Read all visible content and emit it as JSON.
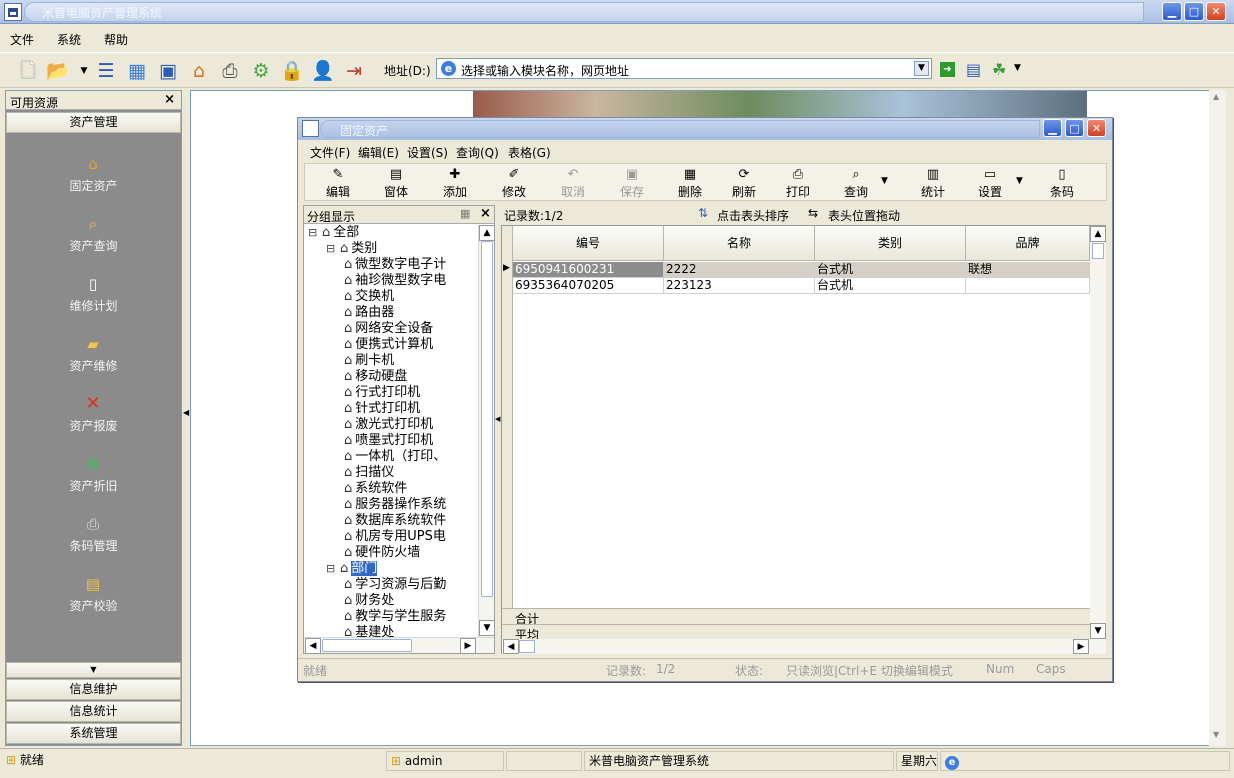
{
  "window": {
    "title": "米普电脑资产管理系统"
  },
  "menubar": [
    "文件",
    "系统",
    "帮助"
  ],
  "address": {
    "label": "地址(D:)",
    "value": "选择或输入模块名称，网页地址"
  },
  "sidebar": {
    "header": "可用资源",
    "close": "×",
    "section_top": "资产管理",
    "items": [
      {
        "label": "固定资产",
        "icon": "house-icon"
      },
      {
        "label": "资产查询",
        "icon": "magnifier-icon"
      },
      {
        "label": "维修计划",
        "icon": "document-icon"
      },
      {
        "label": "资产维修",
        "icon": "folder-icon"
      },
      {
        "label": "资产报废",
        "icon": "red-x-icon"
      },
      {
        "label": "资产折旧",
        "icon": "recycle-icon"
      },
      {
        "label": "条码管理",
        "icon": "printer-icon"
      },
      {
        "label": "资产校验",
        "icon": "checklist-icon"
      }
    ],
    "bottom_sections": [
      "信息维护",
      "信息统计",
      "系统管理"
    ]
  },
  "child": {
    "title": "固定资产",
    "menu": [
      "文件(F)",
      "编辑(E)",
      "设置(S)",
      "查询(Q)",
      "表格(G)"
    ],
    "toolbar": [
      {
        "label": "编辑",
        "icon": "✎",
        "disabled": false
      },
      {
        "label": "窗体",
        "icon": "▤",
        "disabled": false
      },
      {
        "label": "添加",
        "icon": "✚",
        "disabled": false
      },
      {
        "label": "修改",
        "icon": "✐",
        "disabled": false
      },
      {
        "label": "取消",
        "icon": "↶",
        "disabled": true
      },
      {
        "label": "保存",
        "icon": "▣",
        "disabled": true
      },
      {
        "label": "删除",
        "icon": "▦",
        "disabled": false
      },
      {
        "label": "刷新",
        "icon": "⟳",
        "disabled": false
      },
      {
        "label": "打印",
        "icon": "⎙",
        "disabled": false
      },
      {
        "label": "查询",
        "icon": "⌕",
        "disabled": false
      },
      {
        "label": "统计",
        "icon": "▥",
        "disabled": false
      },
      {
        "label": "设置",
        "icon": "▭",
        "disabled": false
      },
      {
        "label": "条码",
        "icon": "▯",
        "disabled": false
      }
    ],
    "group": {
      "header": "分组显示",
      "tree": [
        {
          "label": "全部",
          "level": 0,
          "toggle": "⊟"
        },
        {
          "label": "类别",
          "level": 1,
          "toggle": "⊟"
        },
        {
          "label": "微型数字电子计",
          "level": 2
        },
        {
          "label": "袖珍微型数字电",
          "level": 2
        },
        {
          "label": "交换机",
          "level": 2
        },
        {
          "label": "路由器",
          "level": 2
        },
        {
          "label": "网络安全设备",
          "level": 2
        },
        {
          "label": "便携式计算机",
          "level": 2
        },
        {
          "label": "刷卡机",
          "level": 2
        },
        {
          "label": "移动硬盘",
          "level": 2
        },
        {
          "label": "行式打印机",
          "level": 2
        },
        {
          "label": "针式打印机",
          "level": 2
        },
        {
          "label": "激光式打印机",
          "level": 2
        },
        {
          "label": "喷墨式打印机",
          "level": 2
        },
        {
          "label": "一体机（打印、",
          "level": 2
        },
        {
          "label": "扫描仪",
          "level": 2
        },
        {
          "label": "系统软件",
          "level": 2
        },
        {
          "label": "服务器操作系统",
          "level": 2
        },
        {
          "label": "数据库系统软件",
          "level": 2
        },
        {
          "label": "机房专用UPS电",
          "level": 2
        },
        {
          "label": "硬件防火墙",
          "level": 2
        },
        {
          "label": "部门",
          "level": 1,
          "toggle": "⊟",
          "selected": true
        },
        {
          "label": "学习资源与后勤",
          "level": 2
        },
        {
          "label": "财务处",
          "level": 2
        },
        {
          "label": "教学与学生服务",
          "level": 2
        },
        {
          "label": "基建处",
          "level": 2
        }
      ]
    },
    "record_count": "记录数:1/2",
    "sort_hint": "点击表头排序",
    "drag_hint": "表头位置拖动",
    "columns": [
      "编号",
      "名称",
      "类别",
      "品牌"
    ],
    "rows": [
      {
        "id": "6950941600231",
        "name": "2222",
        "type": "台式机",
        "brand": "联想"
      },
      {
        "id": "6935364070205",
        "name": "223123",
        "type": "台式机",
        "brand": ""
      }
    ],
    "footer_rows": [
      "合计",
      "平均"
    ],
    "status": {
      "ready": "就绪",
      "rec_label": "记录数:",
      "rec_value": "1/2",
      "state_label": "状态:",
      "state_value": "只读浏览|Ctrl+E 切换编辑模式",
      "num": "Num",
      "caps": "Caps"
    }
  },
  "bottombar": {
    "status": "就绪",
    "user": "admin",
    "app": "米普电脑资产管理系统",
    "weekday": "星期六"
  }
}
